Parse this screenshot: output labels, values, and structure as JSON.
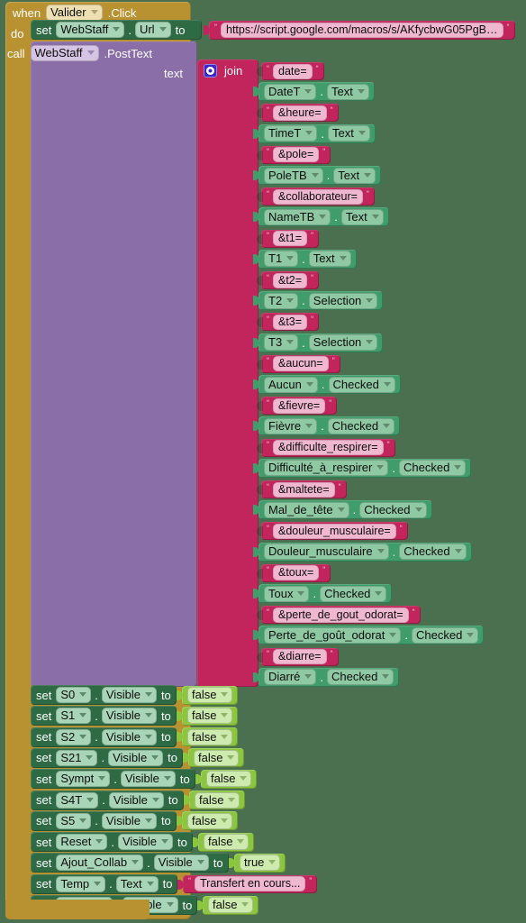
{
  "editor": {
    "background_color": "#4a7050",
    "block_colors": {
      "event_gold": "#b89130",
      "setter_green": "#2e6b44",
      "call_purple": "#8a6ea8",
      "text_magenta": "#c2255c",
      "getter_green": "#3f9d6b",
      "logic_lightgreen": "#8cc63f",
      "mutator_blue": "#3b27c8"
    }
  },
  "event": {
    "when_label": "when",
    "component": "Valider",
    "event_name": ".Click",
    "do_label": "do"
  },
  "set_url": {
    "set_label": "set",
    "component": "WebStaff",
    "dot": ".",
    "property": "Url",
    "to_label": "to",
    "value": "https://script.google.com/macros/s/AKfycbwG05PgB…"
  },
  "call": {
    "call_label": "call",
    "component": "WebStaff",
    "method": ".PostText",
    "arg_label": "text"
  },
  "join": {
    "label": "join",
    "mutator_icon": "gear-icon",
    "items": [
      {
        "kind": "text",
        "value": "date="
      },
      {
        "kind": "getter",
        "component": "DateT",
        "property": "Text"
      },
      {
        "kind": "text",
        "value": "&heure="
      },
      {
        "kind": "getter",
        "component": "TimeT",
        "property": "Text"
      },
      {
        "kind": "text",
        "value": "&pole="
      },
      {
        "kind": "getter",
        "component": "PoleTB",
        "property": "Text"
      },
      {
        "kind": "text",
        "value": "&collaborateur="
      },
      {
        "kind": "getter",
        "component": "NameTB",
        "property": "Text"
      },
      {
        "kind": "text",
        "value": "&t1="
      },
      {
        "kind": "getter",
        "component": "T1",
        "property": "Text"
      },
      {
        "kind": "text",
        "value": "&t2="
      },
      {
        "kind": "getter",
        "component": "T2",
        "property": "Selection"
      },
      {
        "kind": "text",
        "value": "&t3="
      },
      {
        "kind": "getter",
        "component": "T3",
        "property": "Selection"
      },
      {
        "kind": "text",
        "value": "&aucun="
      },
      {
        "kind": "getter",
        "component": "Aucun",
        "property": "Checked"
      },
      {
        "kind": "text",
        "value": "&fievre="
      },
      {
        "kind": "getter",
        "component": "Fièvre",
        "property": "Checked"
      },
      {
        "kind": "text",
        "value": "&difficulte_respirer="
      },
      {
        "kind": "getter",
        "component": "Difficulté_à_respirer",
        "property": "Checked"
      },
      {
        "kind": "text",
        "value": "&maltete="
      },
      {
        "kind": "getter",
        "component": "Mal_de_tête",
        "property": "Checked"
      },
      {
        "kind": "text",
        "value": "&douleur_musculaire="
      },
      {
        "kind": "getter",
        "component": "Douleur_musculaire",
        "property": "Checked"
      },
      {
        "kind": "text",
        "value": "&toux="
      },
      {
        "kind": "getter",
        "component": "Toux",
        "property": "Checked"
      },
      {
        "kind": "text",
        "value": "&perte_de_gout_odorat="
      },
      {
        "kind": "getter",
        "component": "Perte_de_goût_odorat",
        "property": "Checked"
      },
      {
        "kind": "text",
        "value": "&diarre="
      },
      {
        "kind": "getter",
        "component": "Diarré",
        "property": "Checked"
      }
    ]
  },
  "setters": [
    {
      "set_label": "set",
      "component": "S0",
      "property": "Visible",
      "to_label": "to",
      "value": "false",
      "value_kind": "logic"
    },
    {
      "set_label": "set",
      "component": "S1",
      "property": "Visible",
      "to_label": "to",
      "value": "false",
      "value_kind": "logic"
    },
    {
      "set_label": "set",
      "component": "S2",
      "property": "Visible",
      "to_label": "to",
      "value": "false",
      "value_kind": "logic"
    },
    {
      "set_label": "set",
      "component": "S21",
      "property": "Visible",
      "to_label": "to",
      "value": "false",
      "value_kind": "logic"
    },
    {
      "set_label": "set",
      "component": "Sympt",
      "property": "Visible",
      "to_label": "to",
      "value": "false",
      "value_kind": "logic"
    },
    {
      "set_label": "set",
      "component": "S4T",
      "property": "Visible",
      "to_label": "to",
      "value": "false",
      "value_kind": "logic"
    },
    {
      "set_label": "set",
      "component": "S5",
      "property": "Visible",
      "to_label": "to",
      "value": "false",
      "value_kind": "logic"
    },
    {
      "set_label": "set",
      "component": "Reset",
      "property": "Visible",
      "to_label": "to",
      "value": "false",
      "value_kind": "logic"
    },
    {
      "set_label": "set",
      "component": "Ajout_Collab",
      "property": "Visible",
      "to_label": "to",
      "value": "true",
      "value_kind": "logic"
    },
    {
      "set_label": "set",
      "component": "Temp",
      "property": "Text",
      "to_label": "to",
      "value": "Transfert en cours...",
      "value_kind": "text"
    },
    {
      "set_label": "set",
      "component": "Valider",
      "property": "Visible",
      "to_label": "to",
      "value": "false",
      "value_kind": "logic"
    }
  ],
  "punct": {
    "dot": ".",
    "quote": "“"
  }
}
